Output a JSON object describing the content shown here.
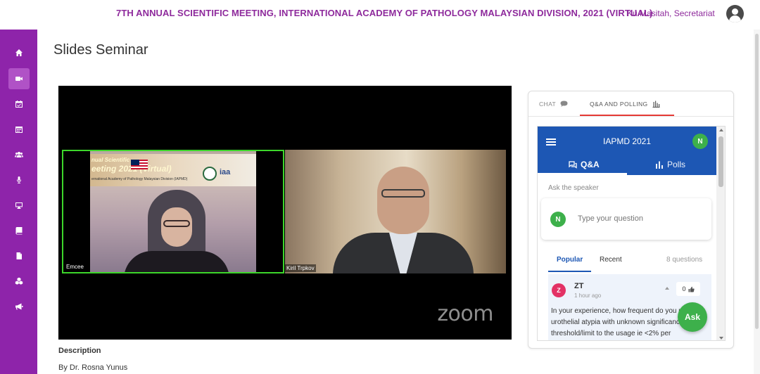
{
  "header": {
    "event_title": "7TH ANNUAL SCIENTIFIC MEETING, INTERNATIONAL ACADEMY OF PATHOLOGY MALAYSIAN DIVISION, 2021 (VIRTUAL)",
    "user_name": "Ku Masitah, Secretariat"
  },
  "sidebar": {
    "items": [
      {
        "icon": "home-icon"
      },
      {
        "icon": "video-camera-icon",
        "active": true
      },
      {
        "icon": "calendar-check-icon"
      },
      {
        "icon": "calendar-icon"
      },
      {
        "icon": "users-icon"
      },
      {
        "icon": "microphone-icon"
      },
      {
        "icon": "monitor-icon"
      },
      {
        "icon": "book-icon"
      },
      {
        "icon": "file-icon"
      },
      {
        "icon": "cubes-icon"
      },
      {
        "icon": "megaphone-icon"
      }
    ]
  },
  "page": {
    "title": "Slides Seminar",
    "description_heading": "Description",
    "description_by": "By Dr. Rosna Yunus"
  },
  "video": {
    "tiles": [
      {
        "label": "Emcee"
      },
      {
        "label": "Kiril Trpkov"
      }
    ],
    "banner": {
      "line1": "nual Scientific",
      "line2": "eeting 2021 (Virtual)",
      "line3": "ernational Academy of Pathology Malaysian Division (IAPMD)",
      "logo_text": "iaa"
    },
    "watermark": "zoom"
  },
  "panel": {
    "tabs": [
      {
        "label": "CHAT",
        "icon": "chat-bubble-icon"
      },
      {
        "label": "Q&A AND POLLING",
        "icon": "bar-chart-icon",
        "active": true
      }
    ],
    "embed": {
      "title": "IAPMD 2021",
      "user_initial": "N",
      "tabs": [
        {
          "label": "Q&A",
          "icon": "qa-icon",
          "active": true
        },
        {
          "label": "Polls",
          "icon": "polls-icon"
        }
      ],
      "ask_label": "Ask the speaker",
      "question_placeholder": "Type your question",
      "sort": {
        "popular": "Popular",
        "recent": "Recent",
        "count": "8 questions"
      },
      "question": {
        "initials": "Z",
        "author": "ZT",
        "time": "1 hour ago",
        "likes": "0",
        "text": "In your experience, how frequent do you use urothelial atypia with unknown significance? Any threshold/limit to the usage ie <2% per"
      },
      "ask_button": "Ask"
    }
  },
  "colors": {
    "brand_purple": "#8e24aa",
    "slido_blue": "#1d57b4",
    "accent_red": "#e53935",
    "ask_green": "#3db04b"
  }
}
